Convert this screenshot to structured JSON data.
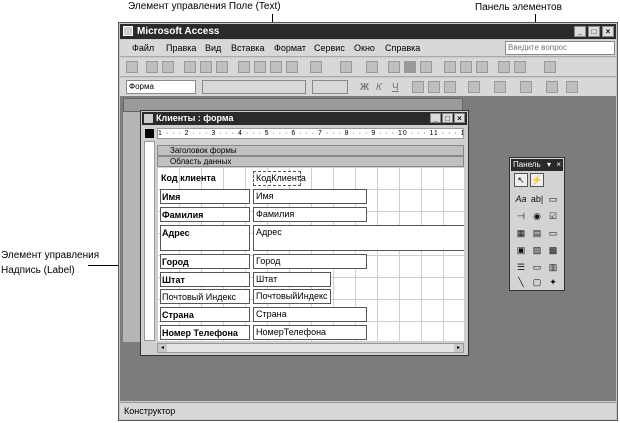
{
  "annotations": {
    "text_control": "Элемент управления Поле (Text)",
    "toolbox_label": "Панель элементов",
    "label_control_line1": "Элемент управления",
    "label_control_line2": "Надпись (Label)"
  },
  "app": {
    "title": "Microsoft Access",
    "help_placeholder": "Введите вопрос",
    "menu": [
      "Файл",
      "Правка",
      "Вид",
      "Вставка",
      "Формат",
      "Сервис",
      "Окно",
      "Справка"
    ],
    "object_combo": "Форма",
    "format_buttons": [
      "Ж",
      "К",
      "Ч"
    ],
    "status": "Конструктор"
  },
  "form": {
    "title": "Клиенты : форма",
    "ruler": "1 · · · 2 · · · 3 · · · 4 · · · 5 · · · 6 · · · 7 · · · 8 · · · 9 · · · 10 · · · 11 · · · 12 · · · 13 · · · 14 ·",
    "header_section": "Заголовок формы",
    "detail_section": "Область данных",
    "rows": [
      {
        "label": "Код клиента",
        "field": "КодКлиента"
      },
      {
        "label": "Имя",
        "field": "Имя"
      },
      {
        "label": "Фамилия",
        "field": "Фамилия"
      },
      {
        "label": "Адрес",
        "field": "Адрес"
      },
      {
        "label": "Город",
        "field": "Город"
      },
      {
        "label": "Штат",
        "field": "Штат"
      },
      {
        "label": "Почтовый Индекс",
        "field": "ПочтовыйИндекс"
      },
      {
        "label": "Страна",
        "field": "Страна"
      },
      {
        "label": "Номер Телефона",
        "field": "НомерТелефона"
      }
    ]
  },
  "toolbox": {
    "title": "Панель",
    "tools": [
      "↖",
      "⚡",
      "Aa",
      "ab|",
      "▭",
      "⊣",
      "◉",
      "☑",
      "▦",
      "▤",
      "▭",
      "▣",
      "▨",
      "▩",
      "☰",
      "▭",
      "▥",
      "╲",
      "▢",
      "✦"
    ]
  }
}
